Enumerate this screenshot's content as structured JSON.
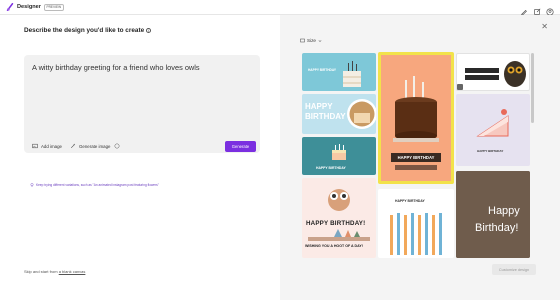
{
  "app": {
    "title": "Designer",
    "badge": "PREVIEW"
  },
  "prompt": {
    "heading": "Describe the design you'd like to create",
    "value": "A witty birthday greeting for a friend who loves owls",
    "idea_text": "Keep trying different variations, such as \"An animated instagram post featuring flowers\""
  },
  "toolbar": {
    "add_image": "Add image",
    "generate_image": "Generate image",
    "generate": "Generate"
  },
  "footer": {
    "skip_prefix": "Skip and start from",
    "skip_link": "a blank canvas"
  },
  "size_dropdown": {
    "label": "Size"
  },
  "designs": {
    "card1": "HAPPY BIRTHDAY",
    "card2_line1": "HAPPY",
    "card2_line2": "BIRTHDAY",
    "card3": "HAPPY BIRTHDAY",
    "card4": "HAPPY BIRTHDAY!",
    "card4_sub": "WISHING YOU A HOOT OF A DAY!",
    "card5": "HAPPY BIRTHDAY",
    "card6": "HAPPY BIRTHDAY",
    "card7_line1": "HAPPY BIRTHDAY!",
    "card7_line2": "WISHING YOU A HOOT OF A DAY!",
    "card8": "HAPPY BIRTHDAY",
    "card9_line1": "Happy",
    "card9_line2": "Birthday!"
  },
  "customize_button": "Customize design",
  "colors": {
    "accent": "#7b2fe0",
    "selection": "#f2e24a"
  }
}
